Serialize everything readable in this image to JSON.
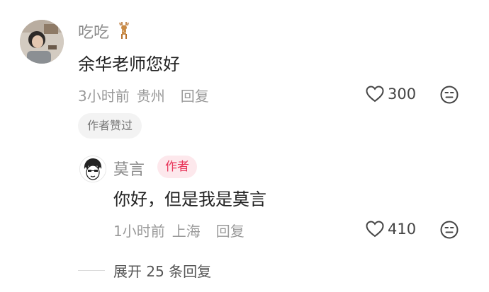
{
  "comment": {
    "author": "吃吃",
    "author_icon": "deer-emoji-icon",
    "text": "余华老师您好",
    "time": "3小时前",
    "location": "贵州",
    "reply_label": "回复",
    "likes": "300",
    "tag": "作者赞过"
  },
  "reply": {
    "author": "莫言",
    "badge": "作者",
    "text": "你好，但是我是莫言",
    "time": "1小时前",
    "location": "上海",
    "reply_label": "回复",
    "likes": "410"
  },
  "expand_label": "展开 25 条回复",
  "colors": {
    "badge_text": "#e8355a",
    "badge_bg": "#fde8ec",
    "muted_text": "#9a9a9a"
  }
}
